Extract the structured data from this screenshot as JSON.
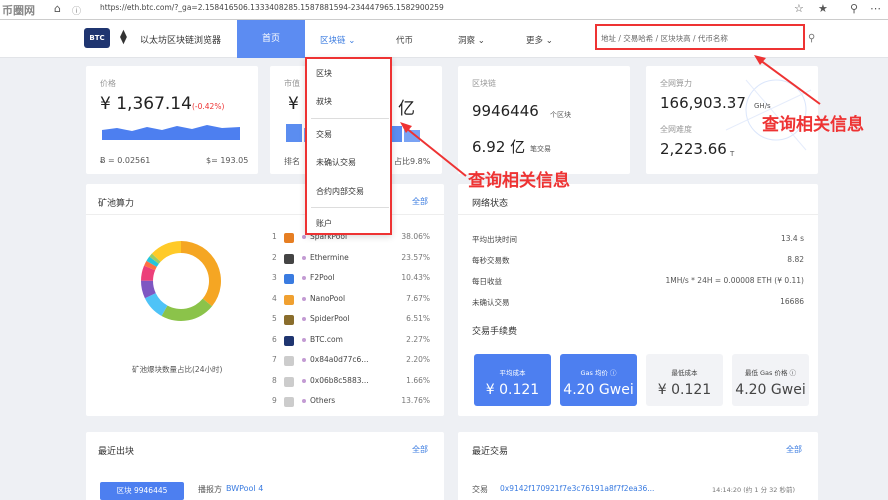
{
  "browser": {
    "url": "https://eth.btc.com/?_ga=2.158416506.1333408285.1587881594-234447965.1582900259"
  },
  "watermark": "币圈网",
  "nav": {
    "logo": "BTC",
    "brand": "以太坊区块链浏览器",
    "home": "首页",
    "blockchain": "区块链",
    "token": "代币",
    "insight": "洞察",
    "more": "更多",
    "search_placeholder": "地址 / 交易哈希 / 区块块高 / 代币名称"
  },
  "dropdown": [
    "区块",
    "叔块",
    "交易",
    "未确认交易",
    "合约内部交易",
    "账户"
  ],
  "annotation": "查询相关信息",
  "price": {
    "label": "价格",
    "value": "¥ 1,367.14",
    "change": "(-0.42%)",
    "btc": "= 0.02561",
    "usd": "= 193.05"
  },
  "market": {
    "label": "市值",
    "value": "¥",
    "value_tail": "亿",
    "rank": "排名",
    "share": "占比9.8%"
  },
  "chain": {
    "label": "区块链",
    "blocks": "9946446",
    "blocks_unit": "个区块",
    "txs": "6.92 亿",
    "txs_unit": "笔交易"
  },
  "hashrate": {
    "label": "全网算力",
    "value": "166,903.37",
    "unit": "GH/s",
    "diff_label": "全网难度",
    "diff": "2,223.66",
    "diff_unit": "T"
  },
  "pools": {
    "title": "矿池算力",
    "all": "全部",
    "caption": "矿池爆块数量占比(24小时)",
    "colors": [
      "#f5a623",
      "#8bc34a",
      "#4fc3f7",
      "#7e57c2",
      "#ec407a",
      "#ff7043",
      "#26c6da",
      "#9ccc65",
      "#ffca28"
    ],
    "items": [
      {
        "n": "1",
        "name": "SparkPool",
        "pct": "38.06%",
        "c": "#e67e22",
        "p": 38.06
      },
      {
        "n": "2",
        "name": "Ethermine",
        "pct": "23.57%",
        "c": "#444",
        "p": 23.57
      },
      {
        "n": "3",
        "name": "F2Pool",
        "pct": "10.43%",
        "c": "#3a7be0",
        "p": 10.43
      },
      {
        "n": "4",
        "name": "NanoPool",
        "pct": "7.67%",
        "c": "#f0a030",
        "p": 7.67
      },
      {
        "n": "5",
        "name": "SpiderPool",
        "pct": "6.51%",
        "c": "#8a6d2c",
        "p": 6.51
      },
      {
        "n": "6",
        "name": "BTC.com",
        "pct": "2.27%",
        "c": "#1f3570",
        "p": 2.27
      },
      {
        "n": "7",
        "name": "0x84a0d77c6...",
        "pct": "2.20%",
        "c": "#ccc",
        "p": 2.2
      },
      {
        "n": "8",
        "name": "0x06b8c5883...",
        "pct": "1.66%",
        "c": "#ccc",
        "p": 1.66
      },
      {
        "n": "9",
        "name": "Others",
        "pct": "13.76%",
        "c": "#ccc",
        "p": 13.76
      }
    ]
  },
  "network": {
    "title": "网络状态",
    "rows": [
      {
        "l": "平均出块时间",
        "v": "13.4 s"
      },
      {
        "l": "每秒交易数",
        "v": "8.82"
      },
      {
        "l": "每日收益",
        "v": "1MH/s * 24H = 0.00008 ETH (¥ 0.11)"
      },
      {
        "l": "未确认交易",
        "v": "16686"
      }
    ]
  },
  "fees": {
    "title": "交易手续费",
    "items": [
      {
        "l": "平均成本",
        "v": "¥ 0.121"
      },
      {
        "l": "Gas 均价 ⓘ",
        "v": "4.20 Gwei"
      },
      {
        "l": "最低成本",
        "v": "¥ 0.121"
      },
      {
        "l": "最低 Gas 价格 ⓘ",
        "v": "4.20 Gwei"
      }
    ]
  },
  "recent_blocks": {
    "title": "最近出块",
    "all": "全部",
    "block": "区块 9946445",
    "miner_label": "播报方",
    "miner": "BWPool 4"
  },
  "recent_txs": {
    "title": "最近交易",
    "all": "全部",
    "tx_label": "交易",
    "tx": "0x9142f170921f7e3c76191a8f7f2ea36...",
    "time": "14:14:20 (约 1 分 32 秒前)"
  }
}
